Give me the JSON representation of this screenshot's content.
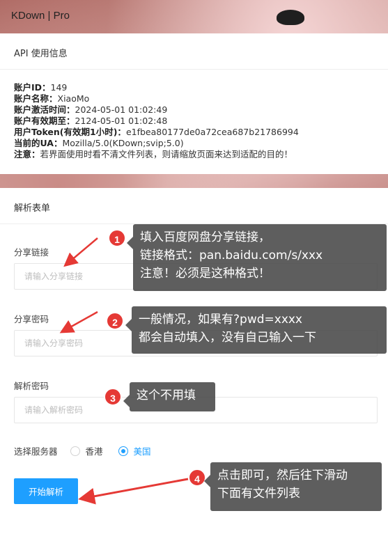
{
  "brand": "KDown | Pro",
  "api_card": {
    "title": "API 使用信息",
    "rows": [
      {
        "key": "账户ID：",
        "value": "149"
      },
      {
        "key": "账户名称：",
        "value": "XiaoMo"
      },
      {
        "key": "账户激活时间：",
        "value": "2024-05-01 01:02:49"
      },
      {
        "key": "账户有效期至：",
        "value": "2124-05-01 01:02:48"
      },
      {
        "key": "用户Token(有效期1小时)：",
        "value": "e1fbea80177de0a72cea687b21786994"
      },
      {
        "key": "当前的UA：",
        "value": "Mozilla/5.0(KDown;svip;5.0)"
      },
      {
        "key": "注意：",
        "value": "若界面使用时看不清文件列表，则请缩放页面来达到适配的目的！"
      }
    ]
  },
  "form_card": {
    "title": "解析表单",
    "share_link": {
      "label": "分享链接",
      "placeholder": "请输入分享链接"
    },
    "share_pwd": {
      "label": "分享密码",
      "placeholder": "请输入分享密码"
    },
    "parse_pwd": {
      "label": "解析密码",
      "placeholder": "请输入解析密码"
    },
    "server": {
      "label": "选择服务器",
      "options": [
        {
          "label": "香港",
          "checked": false
        },
        {
          "label": "美国",
          "checked": true
        }
      ]
    },
    "submit_label": "开始解析"
  },
  "callouts": [
    {
      "num": "1",
      "lines": [
        "填入百度网盘分享链接，",
        "链接格式：pan.baidu.com/s/xxx",
        "注意！必须是这种格式！"
      ]
    },
    {
      "num": "2",
      "lines": [
        "一般情况，如果有?pwd=xxxx",
        "都会自动填入，没有自己输入一下"
      ]
    },
    {
      "num": "3",
      "lines": [
        "这个不用填"
      ]
    },
    {
      "num": "4",
      "lines": [
        "点击即可，然后往下滑动",
        "下面有文件列表"
      ]
    }
  ],
  "colors": {
    "accent": "#1e9fff",
    "badge": "#e53935",
    "arrow": "#e53935"
  }
}
